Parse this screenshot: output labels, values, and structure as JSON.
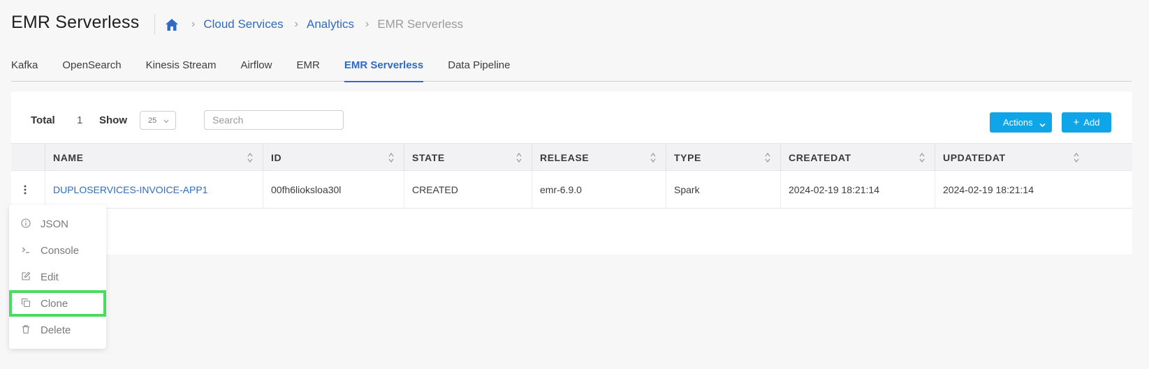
{
  "header": {
    "title": "EMR Serverless",
    "breadcrumb": {
      "home_icon": "home-icon",
      "items": [
        "Cloud Services",
        "Analytics"
      ],
      "current": "EMR Serverless"
    }
  },
  "tabs": [
    {
      "label": "Kafka"
    },
    {
      "label": "OpenSearch"
    },
    {
      "label": "Kinesis Stream"
    },
    {
      "label": "Airflow"
    },
    {
      "label": "EMR"
    },
    {
      "label": "EMR Serverless"
    },
    {
      "label": "Data Pipeline"
    }
  ],
  "active_tab": "EMR Serverless",
  "toolbar": {
    "total_label": "Total",
    "total_value": "1",
    "show_label": "Show",
    "show_value": "25",
    "search_placeholder": "Search",
    "actions_label": "Actions",
    "add_label": "Add"
  },
  "table": {
    "columns": [
      "NAME",
      "ID",
      "STATE",
      "RELEASE",
      "TYPE",
      "CREATEDAT",
      "UPDATEDAT"
    ],
    "rows": [
      {
        "name": "DUPLOSERVICES-INVOICE-APP1",
        "id": "00fh6liokslоa30l",
        "state": "CREATED",
        "release": "emr-6.9.0",
        "type": "Spark",
        "createdat": "2024-02-19 18:21:14",
        "updatedat": "2024-02-19 18:21:14"
      }
    ]
  },
  "row_menu": {
    "items": [
      {
        "label": "JSON",
        "icon": "info-icon"
      },
      {
        "label": "Console",
        "icon": "terminal-icon"
      },
      {
        "label": "Edit",
        "icon": "edit-icon"
      },
      {
        "label": "Clone",
        "icon": "copy-icon"
      },
      {
        "label": "Delete",
        "icon": "trash-icon"
      }
    ],
    "highlighted": "Clone"
  },
  "colors": {
    "accent": "#2f6bc4",
    "button": "#0ea5e9",
    "highlight_outline": "#4cd964"
  }
}
